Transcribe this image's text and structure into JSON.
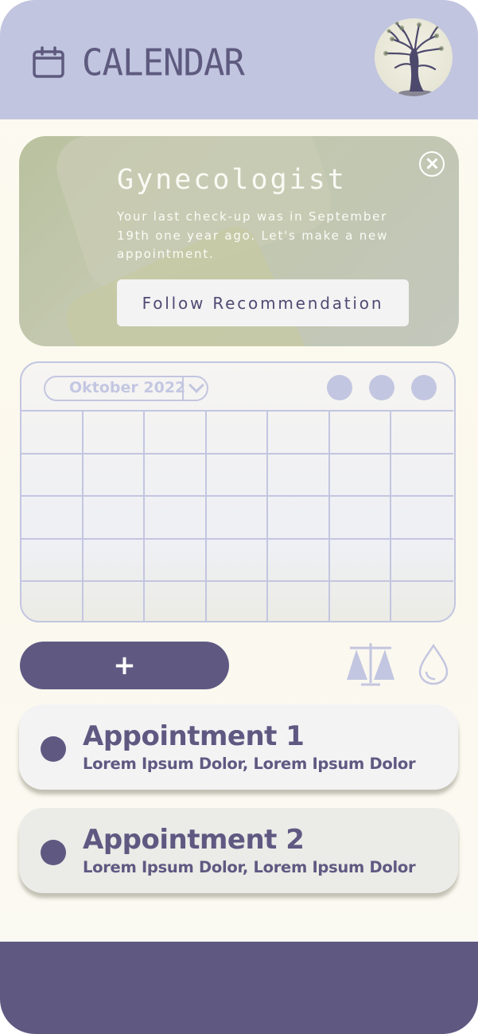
{
  "header": {
    "title": "CALENDAR",
    "calendar_icon": "calendar-icon",
    "avatar_icon": "tree-avatar"
  },
  "recommendation": {
    "title": "Gynecologist",
    "text": "Your last check-up was in September 19th one year ago. Let's make a new appointment.",
    "button_label": "Follow Recommendation",
    "close_icon": "close-circle-icon"
  },
  "calendar": {
    "month": "Oktober 2022",
    "rows": 5,
    "cols": 7
  },
  "actions": {
    "add_label": "+",
    "scale_icon": "scale-icon",
    "drop_icon": "drop-icon"
  },
  "appointments": [
    {
      "title": "Appointment 1",
      "subtitle": "Lorem Ipsum Dolor, Lorem Ipsum Dolor"
    },
    {
      "title": "Appointment 2",
      "subtitle": "Lorem Ipsum Dolor, Lorem Ipsum Dolor"
    }
  ],
  "colors": {
    "primary": "#5f5982",
    "header_bg": "#c1c5df",
    "calendar_line": "#c3c6e0",
    "card_green": "#c2c7b2"
  }
}
